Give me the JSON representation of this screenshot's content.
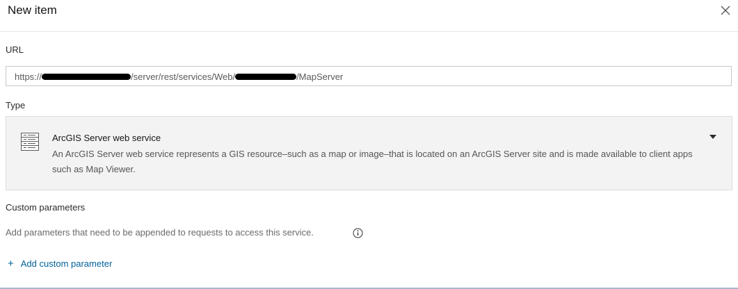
{
  "dialog": {
    "title": "New item",
    "close_icon": "close-icon"
  },
  "url": {
    "label": "URL",
    "value_prefix": "https://",
    "value_middle": "/server/rest/services/Web/",
    "value_suffix": "/MapServer"
  },
  "type": {
    "label": "Type",
    "selected_name": "ArcGIS Server web service",
    "selected_description": "An ArcGIS Server web service represents a GIS resource–such as a map or image–that is located on an ArcGIS Server site and is made available to client apps such as Map Viewer.",
    "icon": "service-list-icon",
    "dropdown_icon": "caret-down-icon"
  },
  "custom_parameters": {
    "label": "Custom parameters",
    "hint": "Add parameters that need to be appended to requests to access this service.",
    "info_icon": "info-icon",
    "add_label": "Add custom parameter",
    "add_icon": "plus-icon"
  },
  "colors": {
    "link": "#00619b",
    "type_box_bg": "#f3f3f3"
  }
}
